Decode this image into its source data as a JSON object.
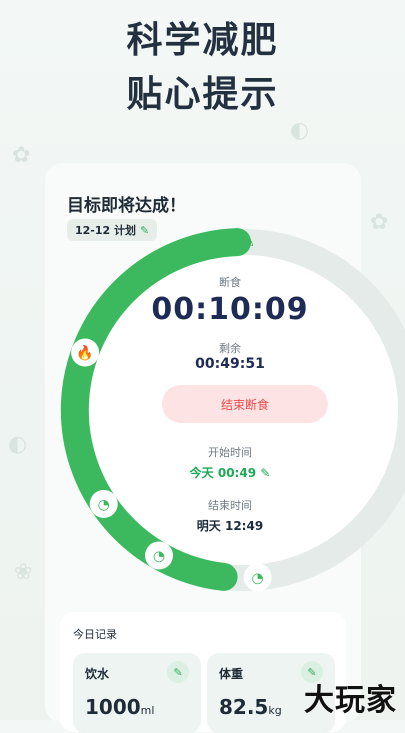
{
  "headline": {
    "line1": "科学减肥",
    "line2": "贴心提示"
  },
  "card": {
    "title": "目标即将达成！",
    "plan_label": "12-12 计划",
    "plan_edit_icon": "pencil-icon"
  },
  "timer": {
    "fast_label": "断食",
    "elapsed": "00:10:09",
    "remaining_label": "剩余",
    "remaining": "00:49:51",
    "end_button": "结束断食",
    "start_label": "开始时间",
    "start_value": "今天 00:49",
    "end_label": "结束时间",
    "end_value": "明天 12:49",
    "progress": 0.85,
    "accent": "#3cb95f",
    "track": "#e6ece9"
  },
  "records": {
    "title": "今日记录",
    "water": {
      "name": "饮水",
      "value": "1000",
      "unit": "ml"
    },
    "weight": {
      "name": "体重",
      "value": "82.5",
      "unit": "kg"
    }
  },
  "watermark": "大玩家"
}
